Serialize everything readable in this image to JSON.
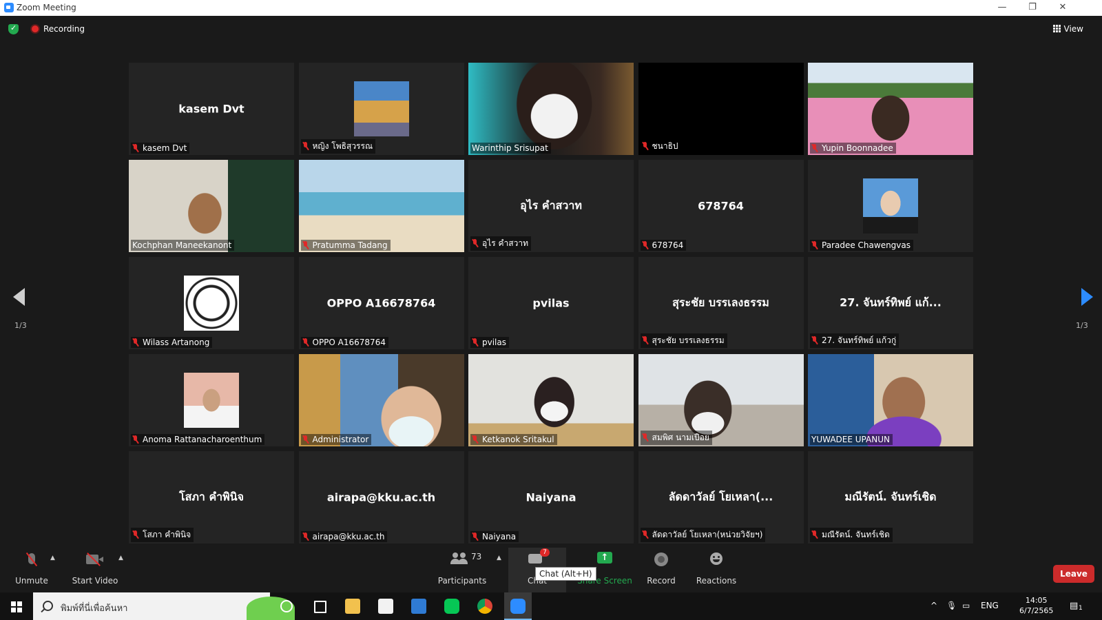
{
  "window": {
    "title": "Zoom Meeting"
  },
  "top_bar": {
    "recording_label": "Recording",
    "view_label": "View"
  },
  "pager": {
    "left": "1/3",
    "right": "1/3"
  },
  "tiles": [
    {
      "name": "kasem Dvt",
      "big": "kasem Dvt",
      "type": "text"
    },
    {
      "name": "หญิง โพธิสุวรรณ",
      "big": "",
      "type": "photo"
    },
    {
      "name": "Warinthip Srisupat",
      "big": "",
      "type": "video",
      "active": true
    },
    {
      "name": "ชนาธิป",
      "big": "",
      "type": "black"
    },
    {
      "name": "Yupin Boonnadee",
      "big": "",
      "type": "video"
    },
    {
      "name": "Kochphan Maneekanont",
      "big": "",
      "type": "video"
    },
    {
      "name": "Pratumma Tadang",
      "big": "",
      "type": "video"
    },
    {
      "name": "อุไร  คำสวาท",
      "big": "อุไร  คำสวาท",
      "type": "text"
    },
    {
      "name": "678764",
      "big": "678764",
      "type": "text"
    },
    {
      "name": "Paradee Chawengvas",
      "big": "",
      "type": "photo"
    },
    {
      "name": "Wilass Artanong",
      "big": "",
      "type": "logo"
    },
    {
      "name": "OPPO A16678764",
      "big": "OPPO A16678764",
      "type": "text"
    },
    {
      "name": "pvilas",
      "big": "pvilas",
      "type": "text"
    },
    {
      "name": "สุระชัย บรรเลงธรรม",
      "big": "สุระชัย บรรเลงธรรม",
      "type": "text"
    },
    {
      "name": "27. จันทร์ทิพย์ แก้วกู่",
      "big": "27. จันทร์ทิพย์ แก้...",
      "type": "text"
    },
    {
      "name": "Anoma Rattanacharoenthum",
      "big": "",
      "type": "photo"
    },
    {
      "name": "Administrator",
      "big": "",
      "type": "video"
    },
    {
      "name": "Ketkanok Sritakul",
      "big": "",
      "type": "video"
    },
    {
      "name": "สมพิศ นามเปือย",
      "big": "",
      "type": "video"
    },
    {
      "name": "YUWADEE UPANUN",
      "big": "",
      "type": "video"
    },
    {
      "name": "โสภา คำพินิจ",
      "big": "โสภา คำพินิจ",
      "type": "text"
    },
    {
      "name": "airapa@kku.ac.th",
      "big": "airapa@kku.ac.th",
      "type": "text"
    },
    {
      "name": "Naiyana",
      "big": "Naiyana",
      "type": "text"
    },
    {
      "name": "ลัดดาวัลย์ โยเหลา(หน่วยวิจัยฯ)",
      "big": "ลัดดาวัลย์ โยเหลา(...",
      "type": "text"
    },
    {
      "name": "มณีรัตน์. จันทร์เชิด",
      "big": "มณีรัตน์. จันทร์เชิด",
      "type": "text"
    }
  ],
  "toolbar": {
    "unmute": "Unmute",
    "start_video": "Start Video",
    "participants": "Participants",
    "participants_count": "73",
    "chat": "Chat",
    "chat_badge": "7",
    "chat_tooltip": "Chat (Alt+H)",
    "share_screen": "Share Screen",
    "record": "Record",
    "reactions": "Reactions",
    "leave": "Leave"
  },
  "taskbar": {
    "search_placeholder": "พิมพ์ที่นี่เพื่อค้นหา",
    "lang": "ENG",
    "time": "14:05",
    "date": "6/7/2565",
    "notif_count": "1"
  },
  "colors": {
    "accent": "#2d8cff",
    "muted_mic": "#e02828",
    "active_speaker": "#e7e770",
    "leave": "#cc2b2b",
    "share": "#23a94f"
  }
}
